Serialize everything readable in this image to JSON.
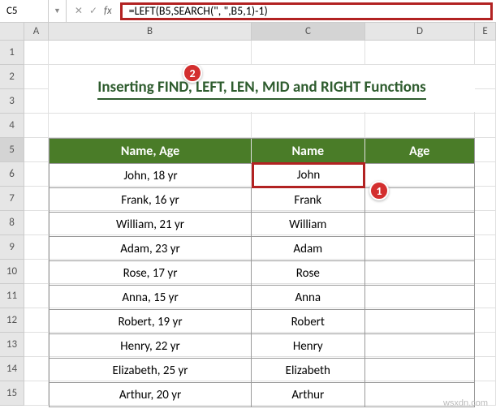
{
  "namebox": "C5",
  "formula": "=LEFT(B5,SEARCH(\", \",B5,1)-1)",
  "columns": [
    "A",
    "B",
    "C",
    "D",
    "E"
  ],
  "rownums": [
    "1",
    "2",
    "3",
    "4",
    "5",
    "6",
    "7",
    "8",
    "9",
    "10",
    "11",
    "12",
    "13",
    "14",
    "15"
  ],
  "title": "Inserting FIND, LEFT, LEN, MID and RIGHT Functions",
  "headers": {
    "c1": "Name, Age",
    "c2": "Name",
    "c3": "Age"
  },
  "rows": [
    {
      "c1": "John, 18 yr",
      "c2": "John",
      "c3": ""
    },
    {
      "c1": "Frank, 16 yr",
      "c2": "Frank",
      "c3": ""
    },
    {
      "c1": "William, 21 yr",
      "c2": "William",
      "c3": ""
    },
    {
      "c1": "Adam, 23 yr",
      "c2": "Adam",
      "c3": ""
    },
    {
      "c1": "Rose, 17 yr",
      "c2": "Rose",
      "c3": ""
    },
    {
      "c1": "Anna, 15 yr",
      "c2": "Anna",
      "c3": ""
    },
    {
      "c1": "Robert, 19 yr",
      "c2": "Robert",
      "c3": ""
    },
    {
      "c1": "Henry, 22 yr",
      "c2": "Henry",
      "c3": ""
    },
    {
      "c1": "Elizabeth, 25 yr",
      "c2": "Elizabeth",
      "c3": ""
    },
    {
      "c1": "Arthur, 20 yr",
      "c2": "Arthur",
      "c3": ""
    }
  ],
  "callouts": {
    "c1": "1",
    "c2": "2"
  },
  "watermark": "wsxdn.com"
}
